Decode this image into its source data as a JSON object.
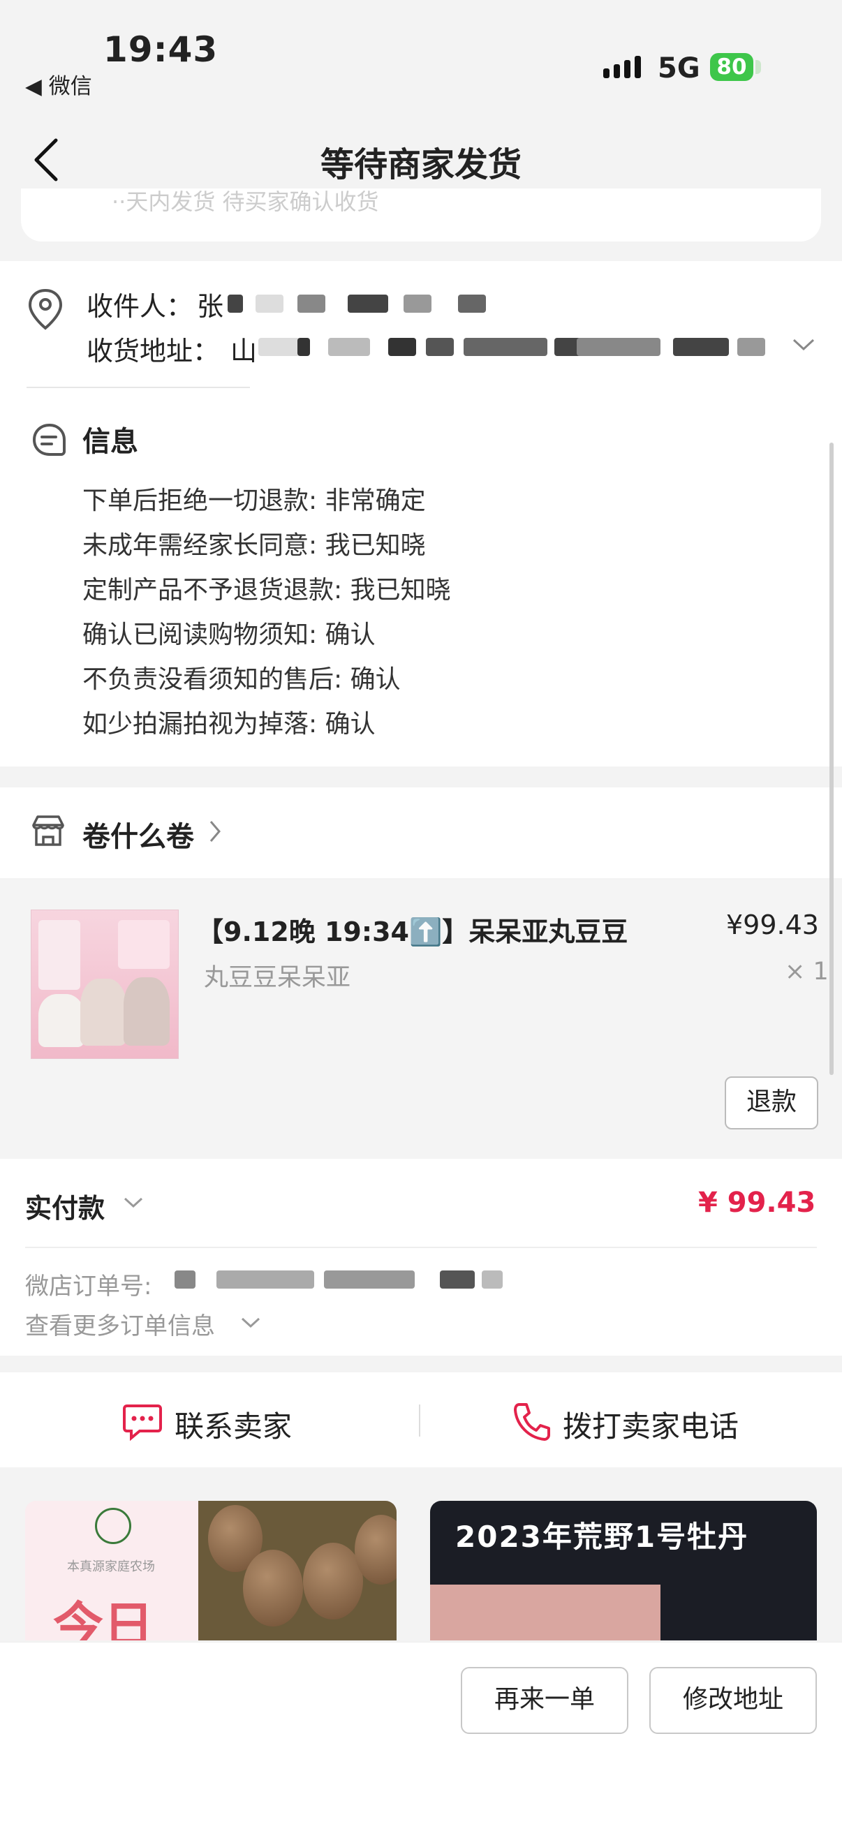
{
  "status_bar": {
    "time": "19:43",
    "back_app": "◀ 微信",
    "network": "5G",
    "battery": "80"
  },
  "nav": {
    "title": "等待商家发货"
  },
  "top_card": {
    "faded_text": "··天内发货       待买家确认收货"
  },
  "address": {
    "recipient_label": "收件人：",
    "recipient_name": "张",
    "address_label": "收货地址：",
    "address_value": "山"
  },
  "info": {
    "title": "信息",
    "lines": [
      "下单后拒绝一切退款: 非常确定",
      "未成年需经家长同意: 我已知晓",
      "定制产品不予退货退款: 我已知晓",
      "确认已阅读购物须知: 确认",
      "不负责没看须知的售后: 确认",
      "如少拍漏拍视为掉落: 确认"
    ]
  },
  "shop": {
    "name": "卷什么卷"
  },
  "product": {
    "title": "【9.12晚 19:34⬆️】呆呆亚丸豆豆",
    "subtitle": "丸豆豆呆呆亚",
    "price": "¥99.43",
    "quantity": "× 1",
    "refund_label": "退款"
  },
  "payment": {
    "label": "实付款",
    "amount": "¥ 99.43",
    "order_no_label": "微店订单号:",
    "more_info": "查看更多订单信息"
  },
  "contact": {
    "seller": "联系卖家",
    "call": "拨打卖家电话"
  },
  "recommend": {
    "item1": {
      "brand": "本真源家庭农场",
      "big": "今日"
    },
    "item2": {
      "title": "2023年荒野1号牡丹"
    }
  },
  "bottom": {
    "reorder": "再来一单",
    "change_address": "修改地址"
  },
  "colors": {
    "accent": "#e3224b",
    "battery": "#3ec64a"
  }
}
